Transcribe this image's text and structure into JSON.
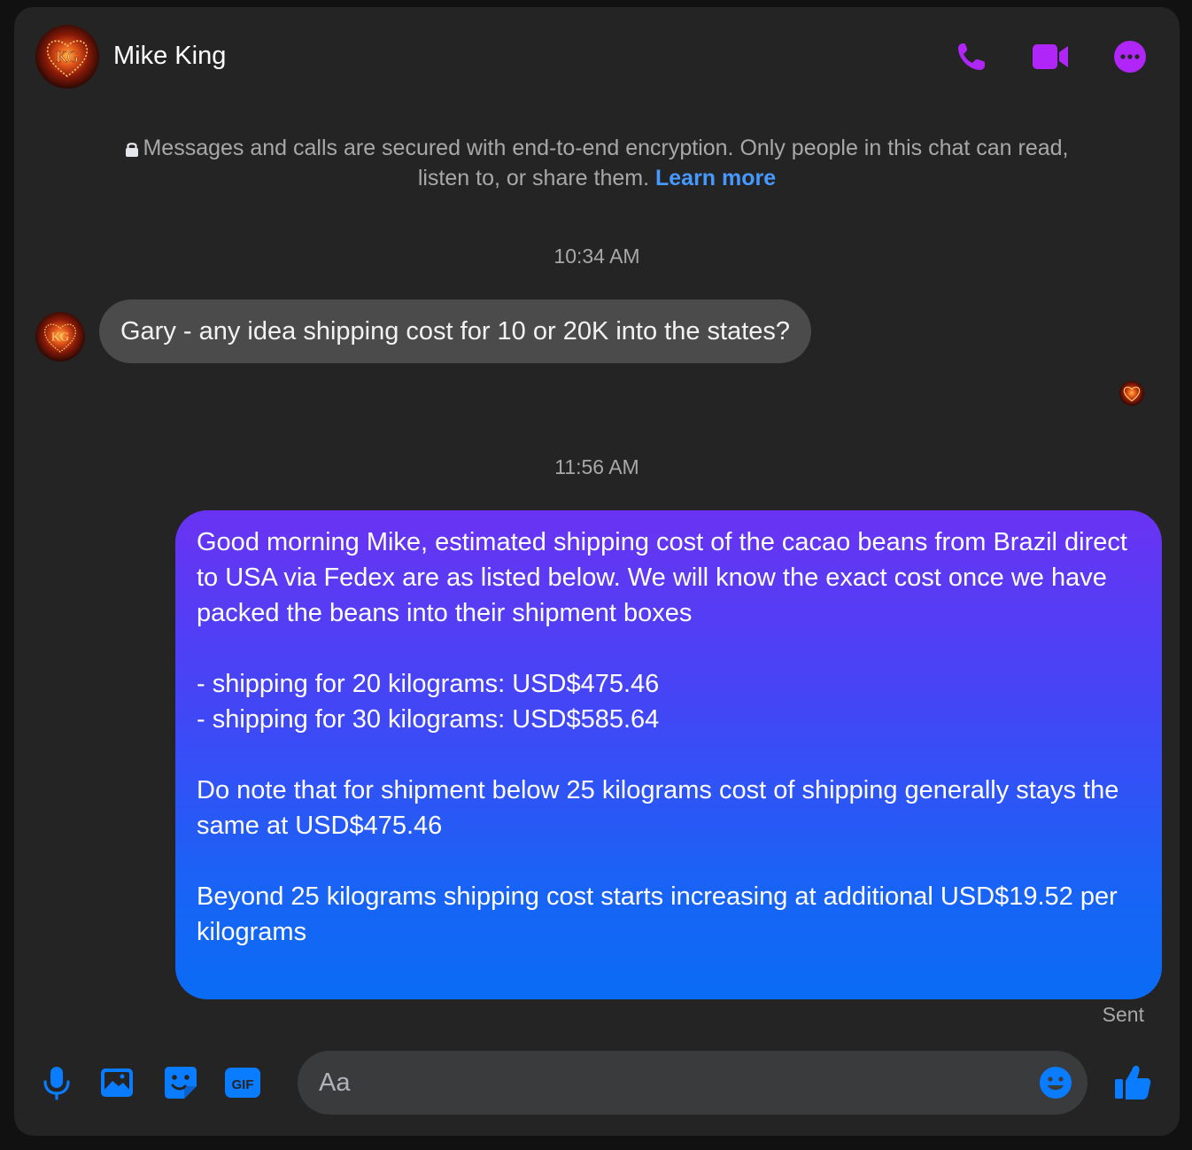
{
  "header": {
    "contact_name": "Mike King",
    "avatar_monogram": "KG",
    "icons": [
      "phone-icon",
      "video-camera-icon",
      "more-options-icon"
    ]
  },
  "encryption_notice": {
    "line1": "Messages and calls are secured with end-to-end encryption. Only people in this chat can read,",
    "line2": "listen to, or share them.",
    "learn_more": "Learn more"
  },
  "conversation": {
    "timestamp_1": "10:34 AM",
    "incoming_message": "Gary - any idea shipping cost for 10 or 20K into the states?",
    "timestamp_2": "11:56 AM",
    "outgoing_message": "Good morning Mike, estimated shipping cost of the cacao beans from Brazil direct to USA via Fedex are as listed below. We will know the exact cost once we have packed the beans into their shipment boxes\n\n- shipping for 20 kilograms: USD$475.46\n- shipping for 30 kilograms: USD$585.64\n\nDo note that for shipment below 25 kilograms cost of shipping generally stays the same at USD$475.46\n\nBeyond 25 kilograms shipping cost starts increasing at additional USD$19.52 per kilograms",
    "status": "Sent"
  },
  "composer": {
    "placeholder": "Aa",
    "gif_label": "GIF",
    "icons": [
      "microphone-icon",
      "image-icon",
      "sticker-icon",
      "gif-icon",
      "emoji-icon",
      "thumbs-up-icon"
    ]
  },
  "colors": {
    "accent_purple": "#b026f8",
    "accent_blue": "#0a7cff",
    "link_blue": "#4599ff",
    "outgoing_gradient_top": "#6a33f3",
    "outgoing_gradient_bottom": "#0a6cf5",
    "incoming_bubble": "#4b4b4b",
    "background": "#242424"
  }
}
